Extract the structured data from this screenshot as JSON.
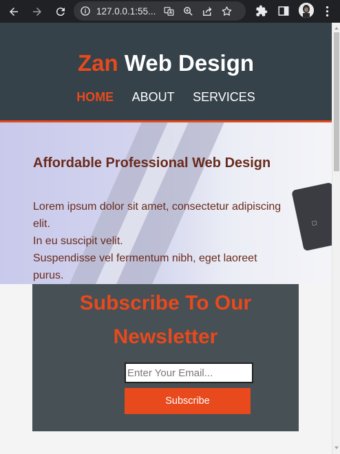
{
  "browser": {
    "url": "127.0.0.1:55...",
    "icons": [
      "back-icon",
      "forward-icon",
      "reload-icon",
      "info-icon",
      "translate-icon",
      "zoom-icon",
      "share-icon",
      "bookmark-star-icon",
      "extensions-icon",
      "side-panel-icon",
      "profile-avatar",
      "more-menu-icon"
    ]
  },
  "header": {
    "brand_highlight": "Zan",
    "brand_rest": " Web Design",
    "nav": [
      {
        "label": "HOME",
        "current": true
      },
      {
        "label": "ABOUT",
        "current": false
      },
      {
        "label": "SERVICES",
        "current": false
      }
    ],
    "accent_color": "#e8491d",
    "background_color": "#35424a"
  },
  "showcase": {
    "heading": "Affordable Professional Web Design",
    "lines": [
      "Lorem ipsum dolor sit amet, consectetur adipiscing",
      "elit.",
      "In eu suscipit velit.",
      "Suspendisse vel fermentum nibh, eget laoreet",
      "purus."
    ]
  },
  "newsletter": {
    "title_line1": "Subscribe To Our",
    "title_line2": "Newsletter",
    "email_placeholder": "Enter Your Email...",
    "button_label": "Subscribe",
    "background_color": "#465055"
  }
}
